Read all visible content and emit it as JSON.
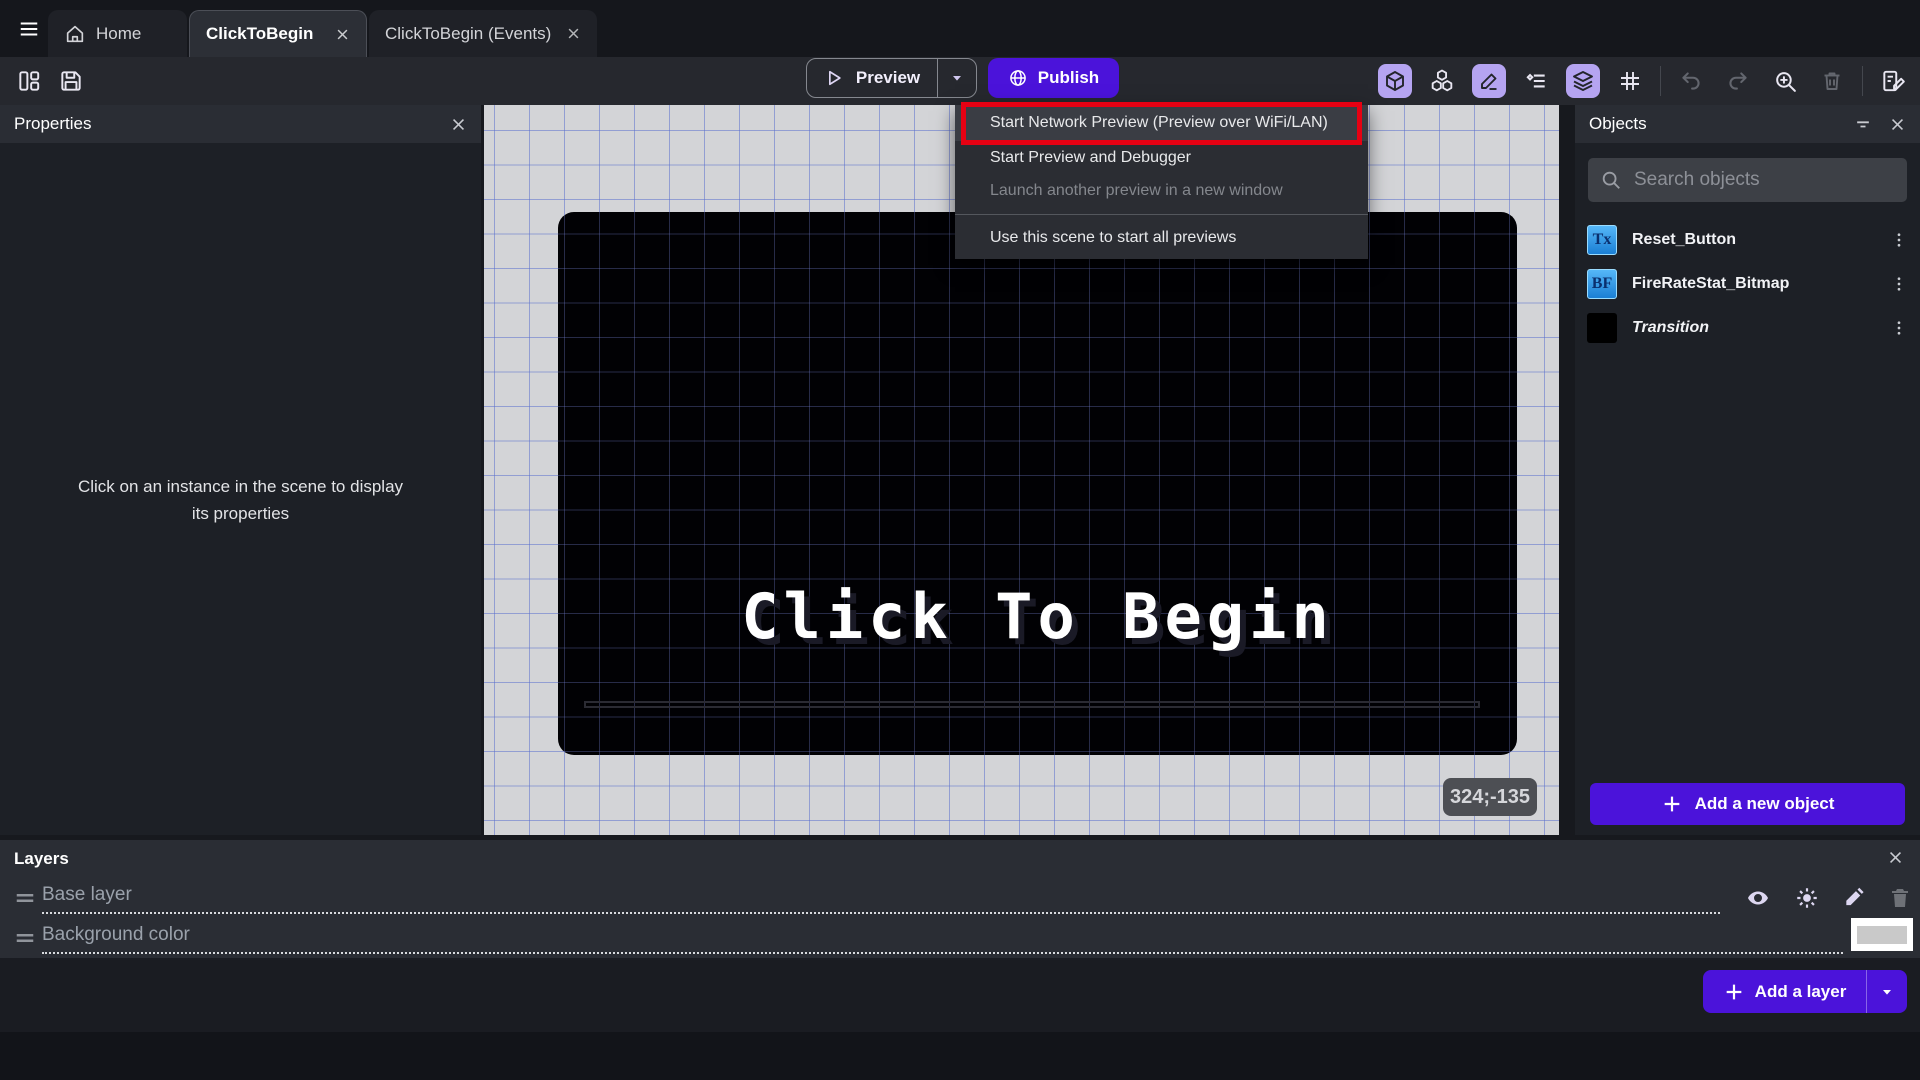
{
  "tab_bar": {
    "tabs": [
      {
        "label": "Home"
      },
      {
        "label": "ClickToBegin"
      },
      {
        "label": "ClickToBegin (Events)"
      }
    ]
  },
  "toolbar": {
    "preview_label": "Preview",
    "publish_label": "Publish"
  },
  "preview_menu": {
    "items": [
      {
        "label": "Start Network Preview (Preview over WiFi/LAN)"
      },
      {
        "label": "Start Preview and Debugger"
      },
      {
        "label": "Launch another preview in a new window"
      },
      {
        "label": "Use this scene to start all previews"
      }
    ],
    "annotation_color": "#e60113"
  },
  "properties_panel": {
    "title": "Properties",
    "empty_message": "Click on an instance in the scene to display its properties"
  },
  "scene_canvas": {
    "game_text": "Click To Begin",
    "cursor_coordinates": "324;-135"
  },
  "objects_panel": {
    "title": "Objects",
    "search_placeholder": "Search objects",
    "objects": [
      {
        "name": "Reset_Button",
        "icon_label": "Tx"
      },
      {
        "name": "FireRateStat_Bitmap",
        "icon_label": "BF"
      },
      {
        "name": "Transition",
        "icon_label": ""
      }
    ],
    "add_button_label": "Add a new object"
  },
  "layers_panel": {
    "title": "Layers",
    "layers": [
      {
        "name": "Base layer"
      },
      {
        "name": "Background color"
      }
    ],
    "add_button_label": "Add a layer"
  },
  "colors": {
    "accent_purple": "#4b13da",
    "toolbar_active_icon_bg": "#b5a4f1",
    "annotation_red": "#e60113",
    "canvas_background": "#d3d4d7",
    "grid_line_blue": "#5c70cd",
    "game_rect_black": "#010104"
  }
}
